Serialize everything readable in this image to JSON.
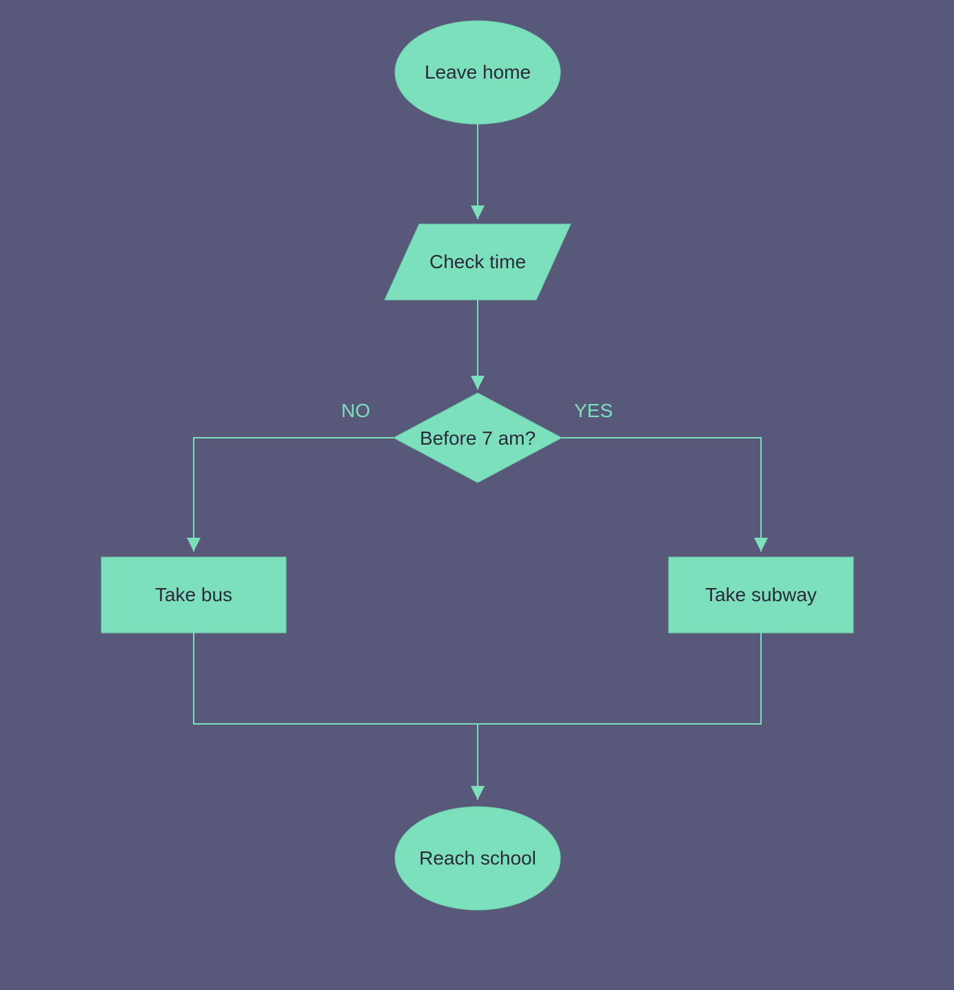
{
  "colors": {
    "background": "#58587a",
    "shapeFill": "#7de0bd",
    "shapeStroke": "#6cc9a7",
    "arrow": "#7de0bd",
    "textDark": "#2a2a3a",
    "textLight": "#7de0bd"
  },
  "nodes": {
    "start": {
      "label": "Leave home",
      "shape": "ellipse"
    },
    "checkTime": {
      "label": "Check time",
      "shape": "parallelogram"
    },
    "decision": {
      "label": "Before 7 am?",
      "shape": "diamond"
    },
    "takeBus": {
      "label": "Take bus",
      "shape": "rectangle"
    },
    "takeSubway": {
      "label": "Take subway",
      "shape": "rectangle"
    },
    "end": {
      "label": "Reach school",
      "shape": "ellipse"
    }
  },
  "edges": {
    "noLabel": "NO",
    "yesLabel": "YES"
  }
}
